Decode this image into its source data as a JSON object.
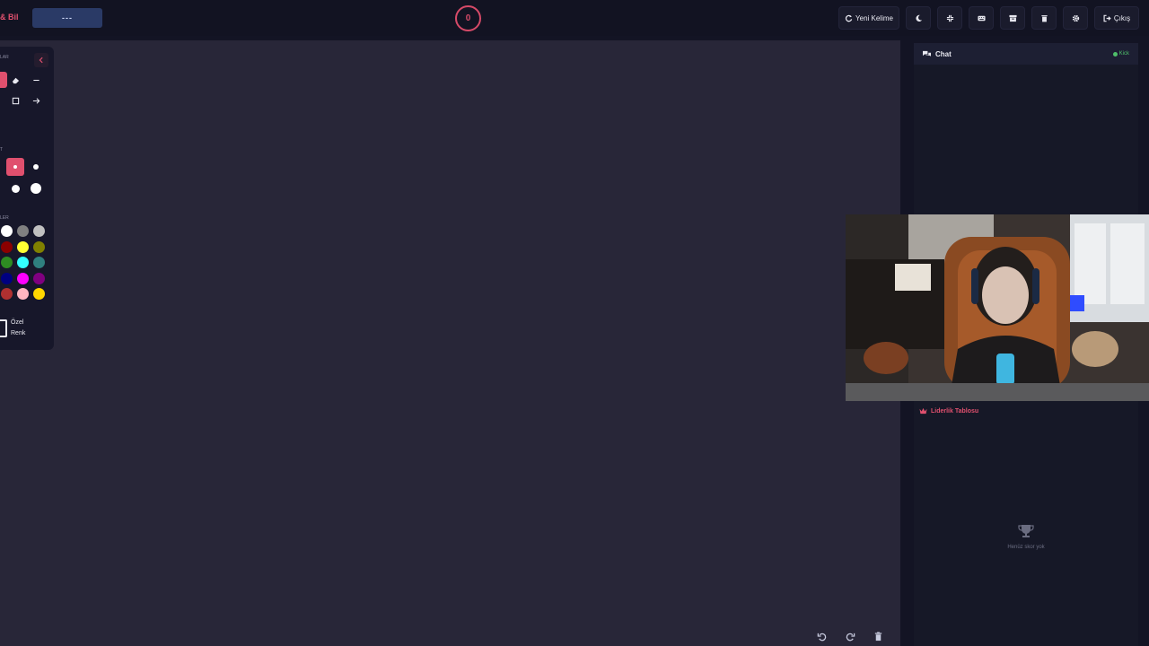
{
  "header": {
    "brand_text": "& Bil",
    "word_hint": "---",
    "timer_value": "0",
    "buttons": {
      "new_word": "Yeni Kelime",
      "exit": "Çıkış"
    }
  },
  "tools": {
    "label_tools": "LAR",
    "label_size": "T",
    "label_colors": "LER",
    "custom_color": [
      "Özel",
      "Renk"
    ],
    "colors": [
      [
        "#ffffff",
        "#808080",
        "#c0c0c0"
      ],
      [
        "#8b0000",
        "#ffff33",
        "#808000"
      ],
      [
        "#2e8b22",
        "#33ffff",
        "#2f7f7f"
      ],
      [
        "#000080",
        "#ff00ff",
        "#800080"
      ],
      [
        "#b03030",
        "#ffb6c1",
        "#ffd700"
      ]
    ]
  },
  "chat": {
    "title": "Chat",
    "platform": "Kick"
  },
  "leaderboard": {
    "title": "Liderlik Tablosu",
    "empty_text": "Henüz skor yok"
  },
  "theme": {
    "accent": "#e0506e",
    "canvas": "#282638",
    "panel": "#161827"
  }
}
